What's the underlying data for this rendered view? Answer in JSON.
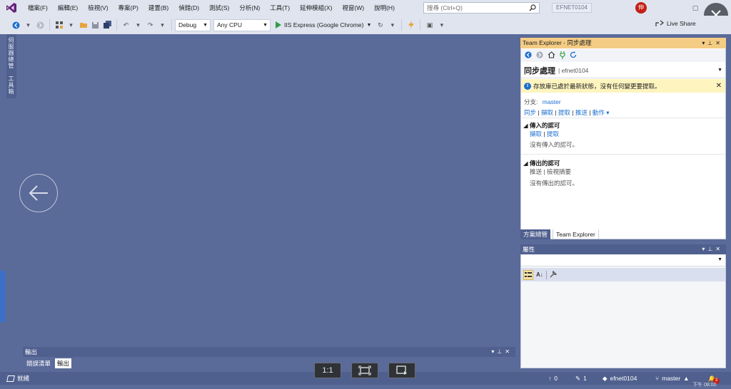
{
  "menu": {
    "items": [
      "檔案(F)",
      "編輯(E)",
      "檢視(V)",
      "專案(P)",
      "建置(B)",
      "偵錯(D)",
      "測試(S)",
      "分析(N)",
      "工具(T)",
      "延伸模組(X)",
      "視窗(W)",
      "說明(H)"
    ],
    "search_placeholder": "搜尋 (Ctrl+Q)",
    "solution_name": "EFNET0104",
    "avatar_letter": "伸",
    "live_share": "Live Share"
  },
  "toolbar": {
    "config": "Debug",
    "platform": "Any CPU",
    "run_target": "IIS Express (Google Chrome)"
  },
  "left_tabs": [
    "伺服器總管",
    "工具箱"
  ],
  "team_explorer": {
    "title": "Team Explorer - 同步處理",
    "header": "同步處理",
    "header_sub": "efnet0104",
    "info": "存放庫已處於最新狀態，沒有任何變更要提取。",
    "branch_label": "分支:",
    "branch": "master",
    "actions": [
      "同步",
      "擷取",
      "提取",
      "推送",
      "動作"
    ],
    "incoming_title": "傳入的認可",
    "incoming_links": [
      "擷取",
      "提取"
    ],
    "incoming_empty": "沒有傳入的認可。",
    "outgoing_title": "傳出的認可",
    "outgoing_links": [
      "推送",
      "檢視摘要"
    ],
    "outgoing_empty": "沒有傳出的認可。",
    "tabs": [
      "方案總管",
      "Team Explorer"
    ]
  },
  "properties": {
    "title": "屬性"
  },
  "output": {
    "title": "輸出",
    "tabs": [
      "錯誤清單",
      "輸出"
    ]
  },
  "viewer": {
    "one_to_one": "1:1"
  },
  "status": {
    "ready": "就緒",
    "up_count": "0",
    "edit_count": "1",
    "repo": "efnet0104",
    "branch": "master",
    "notifications": "3",
    "time_partial": "下午 08:00"
  },
  "colors": {
    "accent_blue": "#1c6ed0",
    "panel_title_active": "#f5cc84",
    "status_bar": "#4f5f8e",
    "editor_bg": "#5a6a99",
    "info_bar": "#fdf4bf"
  }
}
